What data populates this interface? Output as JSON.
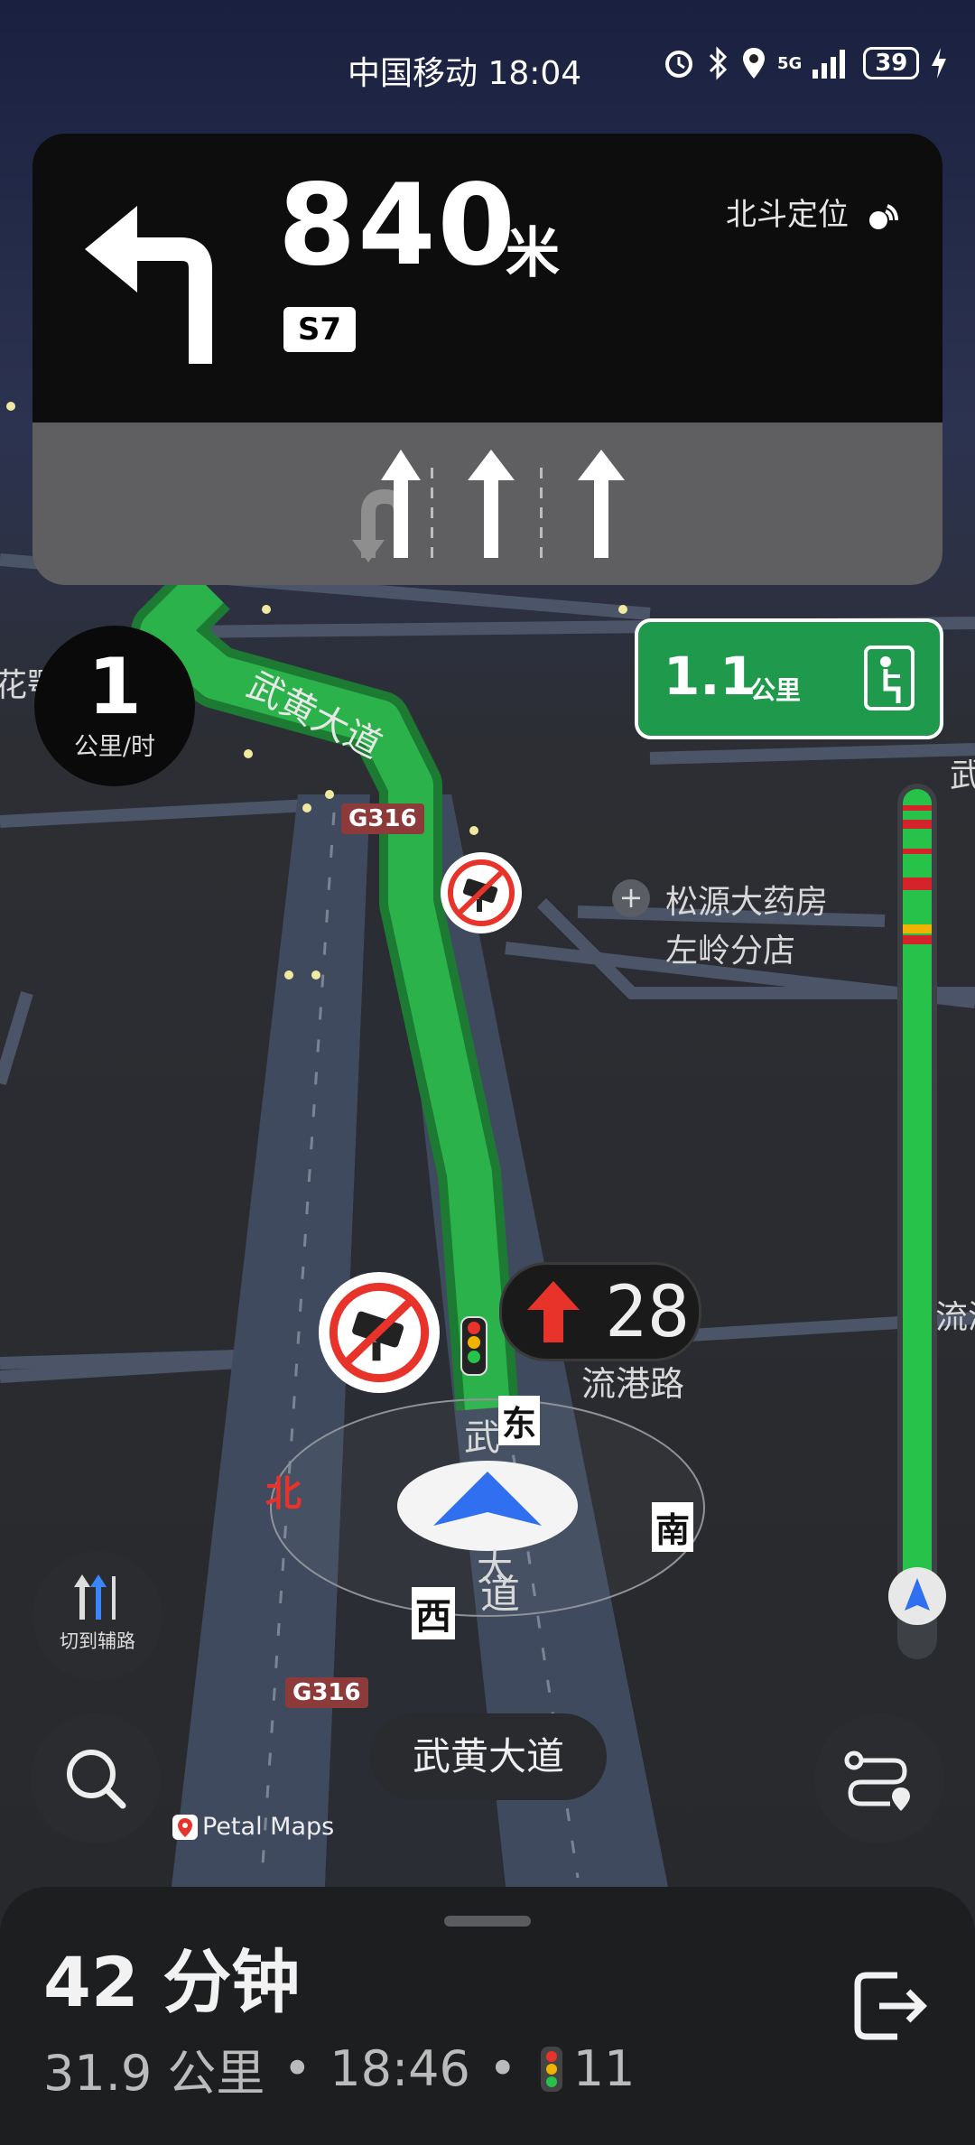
{
  "status_bar": {
    "carrier": "中国移动",
    "time": "18:04",
    "network": "5G",
    "battery": "39"
  },
  "guidance": {
    "distance": "840",
    "unit": "米",
    "road_badge": "S7",
    "positioning": "北斗定位",
    "maneuver_icon": "turn-left-icon"
  },
  "lanes": [
    {
      "icon": "uturn-straight-icon",
      "active": true
    },
    {
      "icon": "straight-icon",
      "active": true
    },
    {
      "icon": "straight-icon",
      "active": true
    }
  ],
  "speed": {
    "value": "1",
    "unit": "公里/时"
  },
  "exit_hint": {
    "distance": "1.1",
    "unit": "公里",
    "icon": "exit-ramp-icon"
  },
  "map": {
    "road_main": "武黄大道",
    "highway_code": "G316",
    "poi_name_1": "松源大药房",
    "poi_name_2": "左岭分店",
    "cross_road": "流港路",
    "edge_label_left": "花鄂",
    "edge_label_right_top": "武",
    "edge_label_right_mid": "流浠",
    "road_vertical_1": "武",
    "road_vertical_2": "大",
    "road_vertical_3": "道",
    "compass": {
      "north": "北",
      "south": "南",
      "east": "东",
      "west": "西"
    },
    "route_color": "#27c24a"
  },
  "signal": {
    "countdown": "28",
    "direction": "straight-arrow-icon",
    "color": "#e8332a"
  },
  "traffic_bar": {
    "segments": [
      "green",
      "red",
      "green",
      "red",
      "green",
      "red",
      "green",
      "yellow",
      "green"
    ],
    "progress": 0.97
  },
  "buttons": {
    "switch_road": "切到辅路",
    "current_road": "武黄大道",
    "search": "search-icon",
    "route_options": "route-options-icon",
    "exit_nav": "exit-nav-icon"
  },
  "brand": "Petal Maps",
  "trip": {
    "duration": "42 分钟",
    "distance": "31.9 公里",
    "arrival": "18:46",
    "lights": "11"
  }
}
